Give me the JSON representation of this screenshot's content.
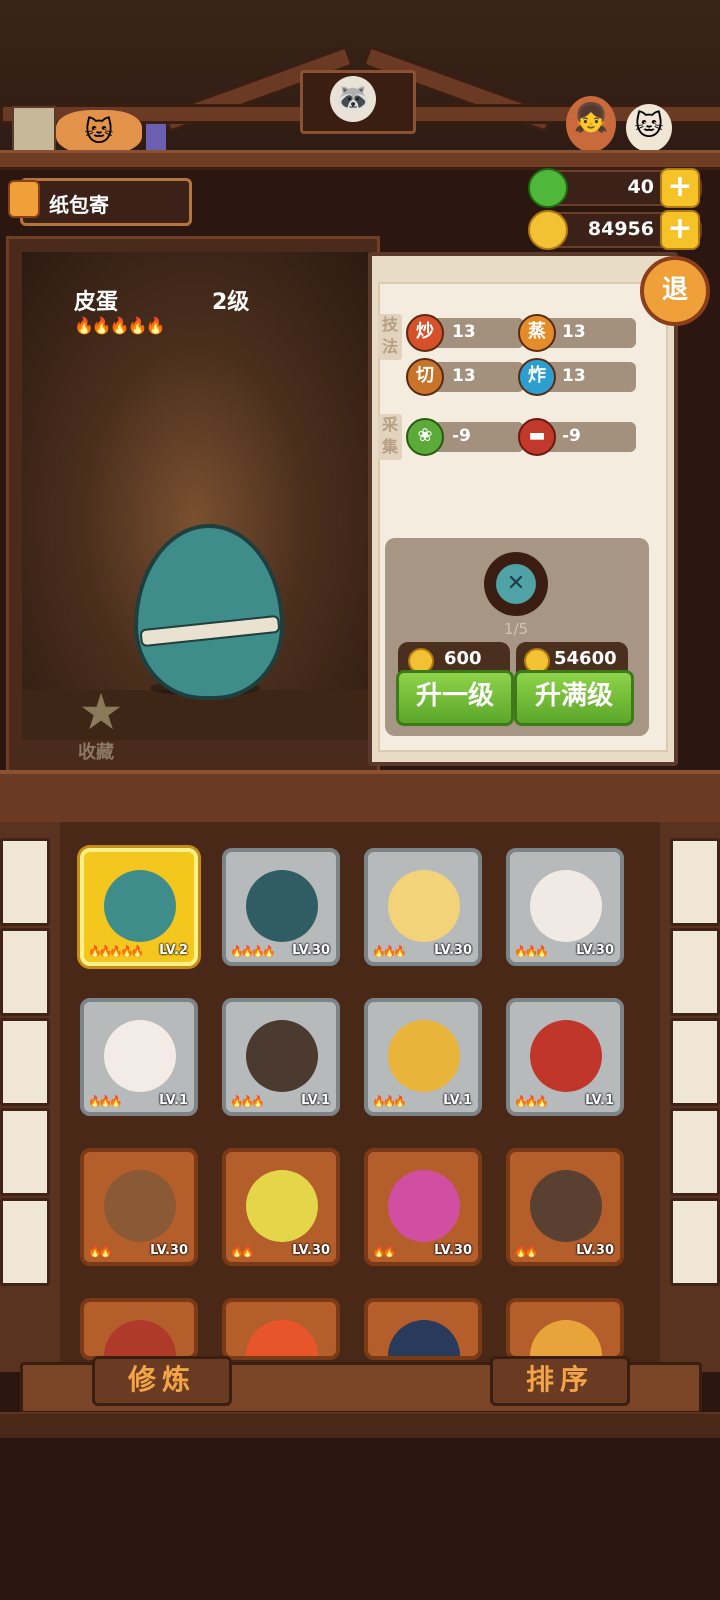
{
  "header": {
    "title": "纸包寄",
    "currency_jade": "40",
    "currency_coin": "84956",
    "quit_label": "退"
  },
  "character": {
    "name": "皮蛋",
    "level": "2级",
    "flames": "🔥🔥🔥🔥🔥",
    "favorite_label": "收藏"
  },
  "panel": {
    "skill_tag": "技法",
    "gather_tag": "采集",
    "skills": [
      {
        "icon": "炒",
        "value": "13",
        "color": "#d6502a"
      },
      {
        "icon": "蒸",
        "value": "13",
        "color": "#e58c2a"
      },
      {
        "icon": "切",
        "value": "13",
        "color": "#c8742a"
      },
      {
        "icon": "炸",
        "value": "13",
        "color": "#2c9ed0"
      }
    ],
    "gather": [
      {
        "icon": "vegetable-icon",
        "value": "-9",
        "color": "#5caa3a"
      },
      {
        "icon": "meat-icon",
        "value": "-9",
        "color": "#c0392b"
      }
    ],
    "gem_count": "1/5",
    "upgrade_one_cost": "600",
    "upgrade_one_label": "升一级",
    "upgrade_max_cost": "54600",
    "upgrade_max_label": "升满级"
  },
  "roster": [
    {
      "lv": "LV.2",
      "frame": "gold",
      "flames": "🔥🔥🔥🔥🔥",
      "color": "#3f8d8a"
    },
    {
      "lv": "LV.30",
      "frame": "silver",
      "flames": "🔥🔥🔥🔥",
      "color": "#2f5d63"
    },
    {
      "lv": "LV.30",
      "frame": "silver",
      "flames": "🔥🔥🔥",
      "color": "#f2d37a"
    },
    {
      "lv": "LV.30",
      "frame": "silver",
      "flames": "🔥🔥🔥",
      "color": "#f1e9e4"
    },
    {
      "lv": "LV.1",
      "frame": "silver",
      "flames": "🔥🔥🔥",
      "color": "#f3ece6"
    },
    {
      "lv": "LV.1",
      "frame": "silver",
      "flames": "🔥🔥🔥",
      "color": "#4a3a30"
    },
    {
      "lv": "LV.1",
      "frame": "silver",
      "flames": "🔥🔥🔥",
      "color": "#e8b43a"
    },
    {
      "lv": "LV.1",
      "frame": "silver",
      "flames": "🔥🔥🔥",
      "color": "#c1362a"
    },
    {
      "lv": "LV.30",
      "frame": "bronze",
      "flames": "🔥🔥",
      "color": "#8a5a36"
    },
    {
      "lv": "LV.30",
      "frame": "bronze",
      "flames": "🔥🔥",
      "color": "#e4d648"
    },
    {
      "lv": "LV.30",
      "frame": "bronze",
      "flames": "🔥🔥",
      "color": "#d04fa0"
    },
    {
      "lv": "LV.30",
      "frame": "bronze",
      "flames": "🔥🔥",
      "color": "#5a4030"
    },
    {
      "lv": "",
      "frame": "bronze",
      "flames": "",
      "color": "#b03a2a"
    },
    {
      "lv": "",
      "frame": "bronze",
      "flames": "",
      "color": "#e8552a"
    },
    {
      "lv": "",
      "frame": "bronze",
      "flames": "",
      "color": "#2a3a5a"
    },
    {
      "lv": "",
      "frame": "bronze",
      "flames": "",
      "color": "#e8a43a"
    }
  ],
  "bottom": {
    "train_label": "修炼",
    "sort_label": "排序"
  }
}
